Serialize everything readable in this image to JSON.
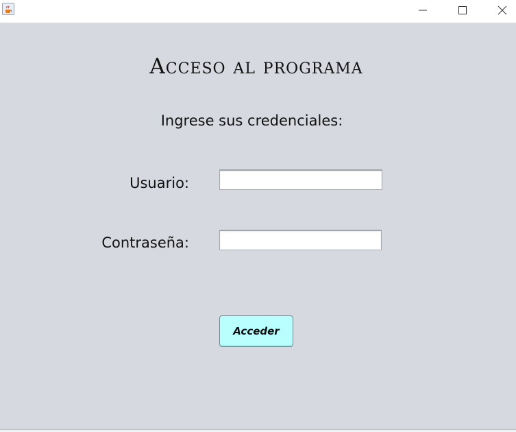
{
  "window": {
    "icon": "java-cup-icon"
  },
  "form": {
    "title": "Acceso al programa",
    "subtitle": "Ingrese sus credenciales:",
    "username_label": "Usuario:",
    "username_value": "",
    "password_label": "Contraseña:",
    "password_value": "",
    "submit_label": "Acceder"
  },
  "colors": {
    "background": "#d6d9df",
    "button": "#b9ffff"
  }
}
